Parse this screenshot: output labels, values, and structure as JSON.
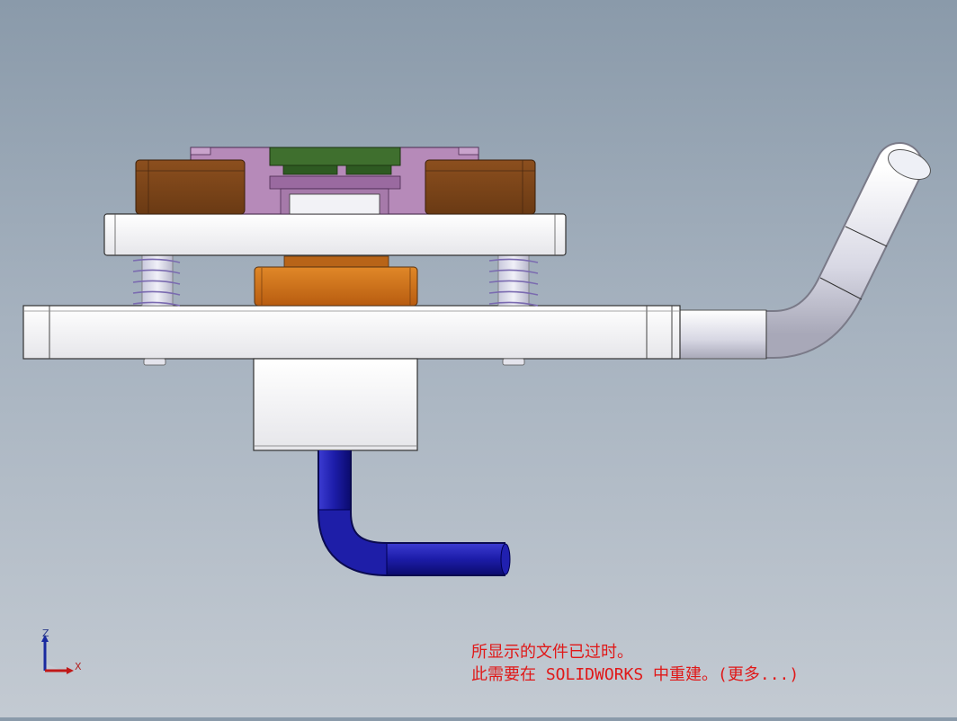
{
  "viewport": {
    "background_top": "#8a9aaa",
    "background_bottom": "#c3cad2"
  },
  "model_colors": {
    "plate": "#f4f4f6",
    "brown_block": "#7a4318",
    "purple_part": "#b58ab8",
    "green_part": "#3c6a2c",
    "orange_cylinder": "#d07218",
    "blue_tube": "#1f1fa0",
    "gray_tube": "#dcdce6"
  },
  "triad": {
    "z_label": "Z",
    "x_label": "X"
  },
  "warning": {
    "line1": "所显示的文件已过时。",
    "line2": "此需要在 SOLIDWORKS 中重建。(更多...)",
    "color": "#e01818"
  }
}
